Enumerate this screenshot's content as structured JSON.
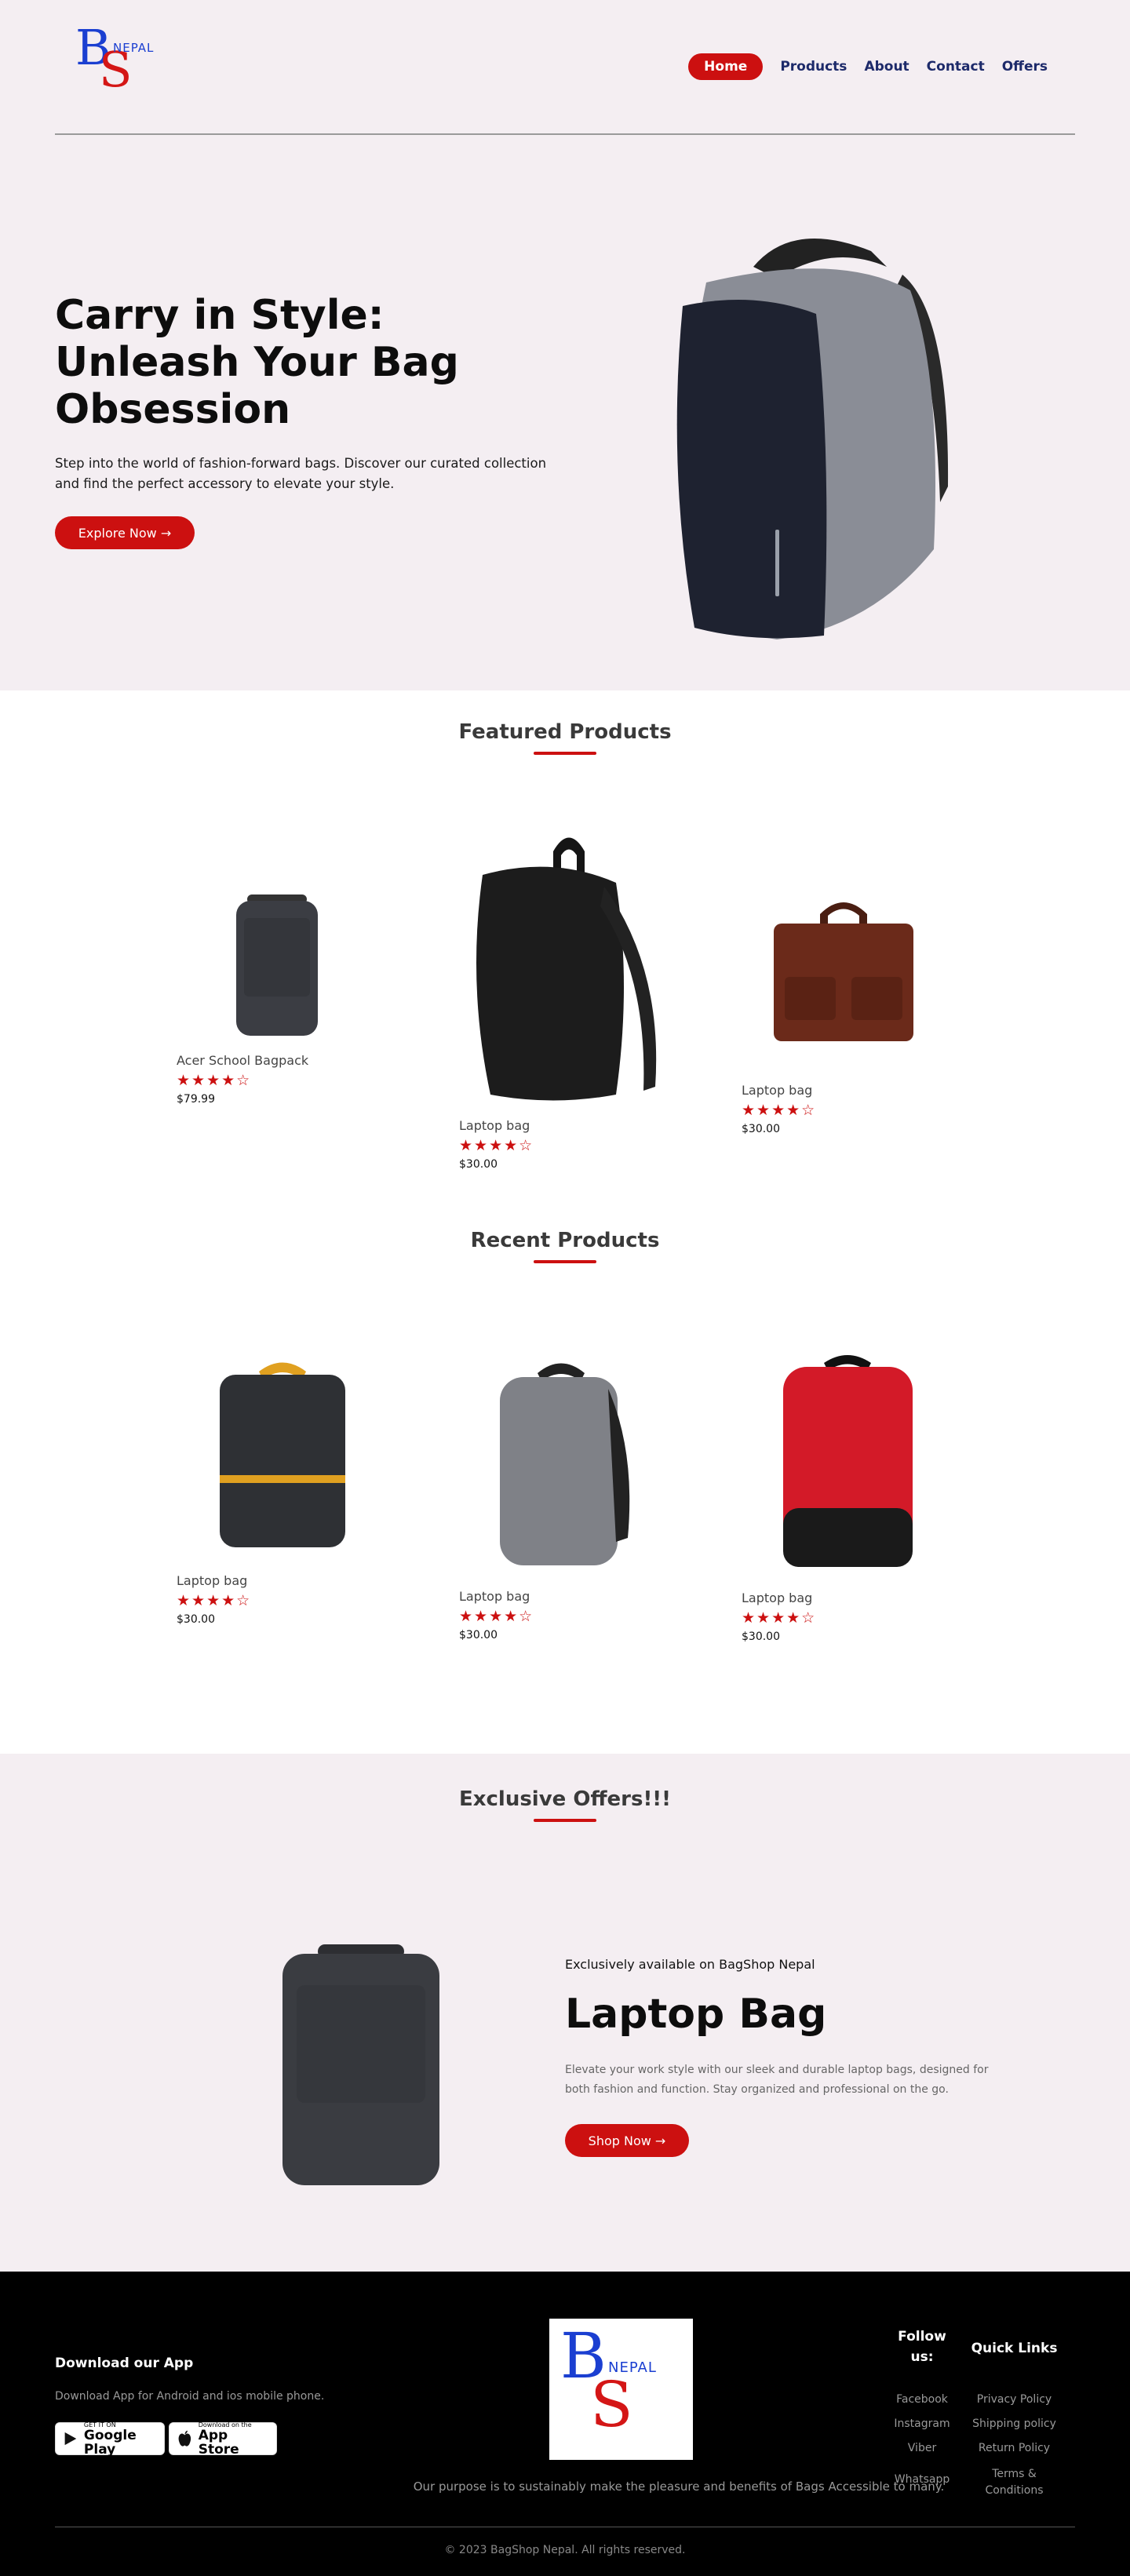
{
  "brand": {
    "logo_b": "B",
    "logo_s": "S",
    "logo_nepal": "NEPAL"
  },
  "nav": {
    "home": "Home",
    "products": "Products",
    "about": "About",
    "contact": "Contact",
    "offers": "Offers"
  },
  "hero": {
    "title": "Carry in Style: Unleash Your Bag Obsession",
    "text": "Step into the world of fashion-forward bags. Discover our curated collection and find the perfect accessory to elevate your style.",
    "button": "Explore Now →"
  },
  "featured": {
    "title": "Featured Products",
    "items": [
      {
        "name": "Acer School Bagpack",
        "stars": "★★★★☆",
        "price": "$79.99",
        "rating": 4
      },
      {
        "name": "Laptop bag",
        "stars": "★★★★☆",
        "price": "$30.00",
        "rating": 4
      },
      {
        "name": "Laptop bag",
        "stars": "★★★★☆",
        "price": "$30.00",
        "rating": 4
      }
    ]
  },
  "recent": {
    "title": "Recent Products",
    "items": [
      {
        "name": "Laptop bag",
        "stars": "★★★★☆",
        "price": "$30.00",
        "rating": 4
      },
      {
        "name": "Laptop bag",
        "stars": "★★★★☆",
        "price": "$30.00",
        "rating": 4
      },
      {
        "name": "Laptop bag",
        "stars": "★★★★☆",
        "price": "$30.00",
        "rating": 4
      }
    ]
  },
  "offers": {
    "title": "Exclusive Offers!!!",
    "kicker": "Exclusively available on BagShop Nepal",
    "product_title": "Laptop Bag",
    "text": "Elevate your work style with our sleek and durable laptop bags, designed for both fashion and function. Stay organized and professional on the go.",
    "button": "Shop Now →"
  },
  "footer": {
    "download_title": "Download our App",
    "download_text": "Download App for Android and ios mobile phone.",
    "google_small": "GET IT ON",
    "google_big": "Google Play",
    "apple_small": "Download on the",
    "apple_big": "App Store",
    "purpose": "Our purpose is to sustainably make the pleasure and benefits of Bags Accessible to many.",
    "follow_title": "Follow us:",
    "follow_links": [
      "Facebook",
      "Instagram",
      "Viber",
      "Whatsapp"
    ],
    "quick_title": "Quick Links",
    "quick_links": [
      "Privacy Policy",
      "Shipping policy",
      "Return Policy",
      "Terms & Conditions"
    ],
    "copyright": "© 2023 BagShop Nepal. All rights reserved."
  },
  "colors": {
    "accent": "#cc1010",
    "hero_bg": "#f4eef2",
    "nav_text": "#1d2a6a",
    "footer_bg": "#000000"
  }
}
